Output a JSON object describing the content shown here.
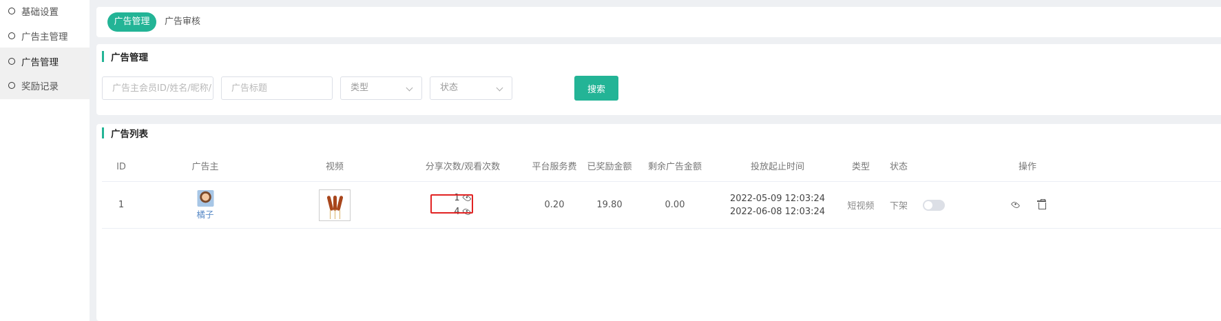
{
  "sidebar": {
    "items": [
      {
        "label": "基础设置",
        "active": false
      },
      {
        "label": "广告主管理",
        "active": false
      },
      {
        "label": "广告管理",
        "active": true
      },
      {
        "label": "奖励记录",
        "active": false
      }
    ]
  },
  "tabs": [
    {
      "label": "广告管理",
      "active": true
    },
    {
      "label": "广告审核",
      "active": false
    }
  ],
  "search": {
    "title": "广告管理",
    "advertiser_placeholder": "广告主会员ID/姓名/昵称/手机号",
    "title_placeholder": "广告标题",
    "type_select": "类型",
    "status_select": "状态",
    "search_button": "搜索"
  },
  "list": {
    "title": "广告列表",
    "columns": [
      "ID",
      "广告主",
      "视频",
      "分享次数/观看次数",
      "平台服务费",
      "已奖励金额",
      "剩余广告金额",
      "投放起止时间",
      "类型",
      "状态",
      "操作"
    ],
    "rows": [
      {
        "id": "1",
        "advertiser": "橘子",
        "shares": "1",
        "views": "4",
        "service_fee": "0.20",
        "rewarded": "19.80",
        "remaining": "0.00",
        "start_time": "2022-05-09 12:03:24",
        "end_time": "2022-06-08 12:03:24",
        "type": "短视频",
        "status": "下架",
        "status_toggle_on": false
      }
    ]
  },
  "icons": {
    "view": "eye-icon",
    "delete": "trash-icon"
  },
  "colors": {
    "accent": "#23b496",
    "highlight_border": "#e12222",
    "link": "#5a8bc7"
  }
}
